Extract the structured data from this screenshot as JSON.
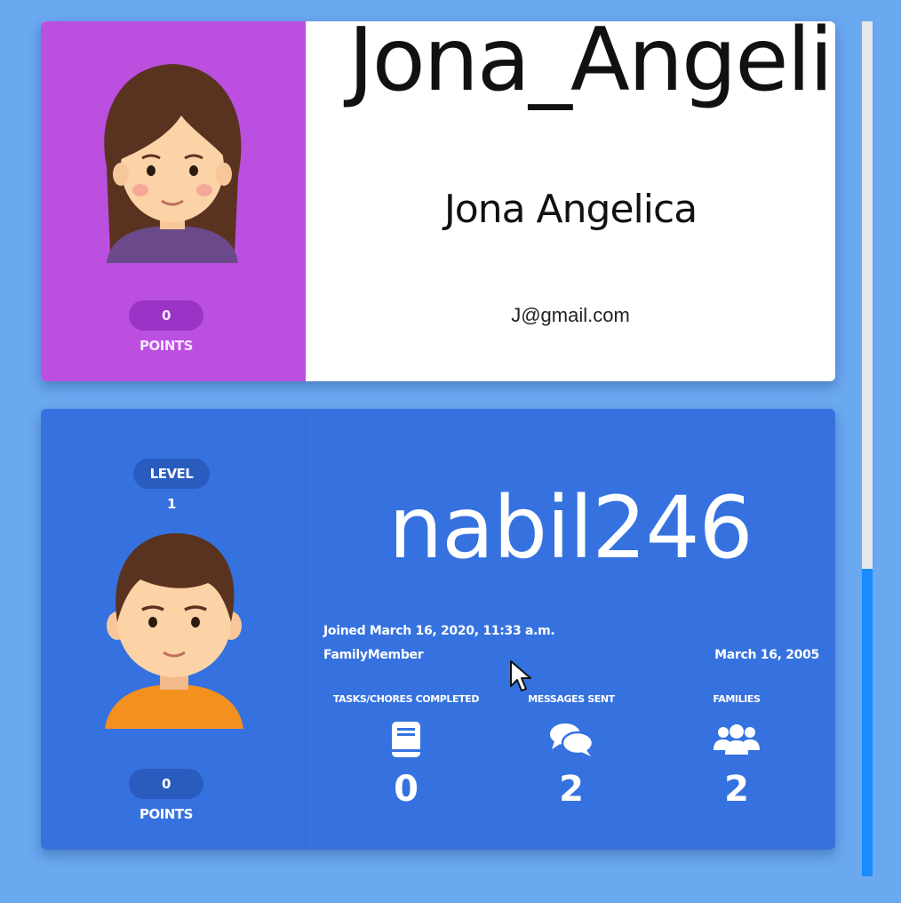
{
  "profiles": [
    {
      "username": "Jona_Angeli",
      "full_name": "Jona Angelica",
      "email": "J@gmail.com",
      "points": "0 POINTS",
      "avatar_icon": "girl-avatar-icon",
      "accent_color": "#bb4fe0"
    },
    {
      "username": "nabil246",
      "level": "LEVEL 1",
      "points": "0 POINTS",
      "avatar_icon": "boy-avatar-icon",
      "joined": "Joined March 16, 2020, 11:33 a.m.",
      "role": "FamilyMember",
      "birthday": "March 16, 2005",
      "accent_color": "#3572e0",
      "stats": [
        {
          "label": "TASKS/CHORES COMPLETED",
          "value": "0",
          "icon": "book-icon"
        },
        {
          "label": "MESSAGES SENT",
          "value": "2",
          "icon": "chat-bubbles-icon"
        },
        {
          "label": "FAMILIES",
          "value": "2",
          "icon": "users-group-icon"
        }
      ]
    }
  ],
  "colors": {
    "page_background": "#6aa8f0",
    "scrollbar_thumb": "#1a8cff"
  }
}
